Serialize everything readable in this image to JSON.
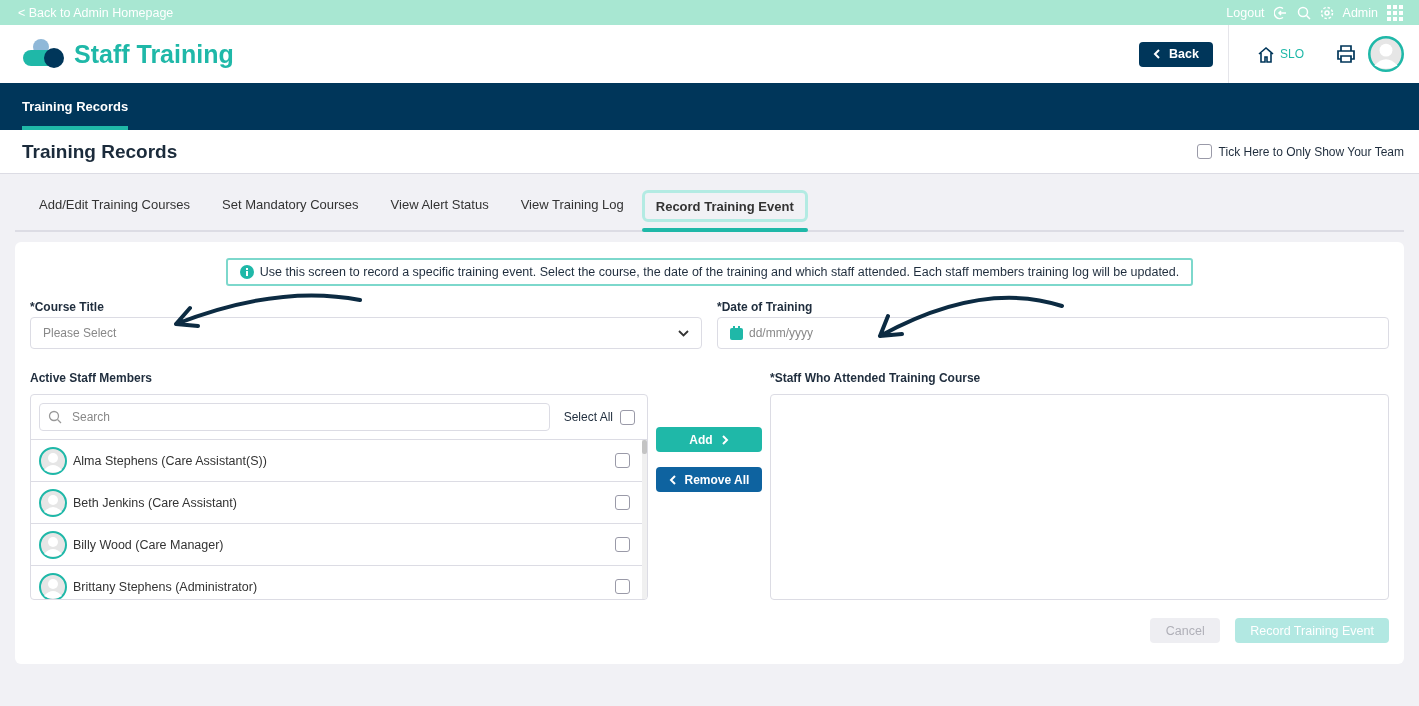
{
  "top_bar": {
    "back_link": "< Back to Admin Homepage",
    "logout": "Logout",
    "user": "Admin"
  },
  "header": {
    "app_title": "Staff Training",
    "back_button": "Back",
    "home_label": "SLO"
  },
  "nav": [
    {
      "label": "Training Records",
      "selected": true
    }
  ],
  "page": {
    "title": "Training Records",
    "team_filter": {
      "label": "Tick Here to Only Show Your Team",
      "checked": false
    }
  },
  "tabs": [
    {
      "label": "Add/Edit Training Courses",
      "selected": false
    },
    {
      "label": "Set Mandatory Courses",
      "selected": false
    },
    {
      "label": "View Alert Status",
      "selected": false
    },
    {
      "label": "View Training Log",
      "selected": false
    },
    {
      "label": "Record Training Event",
      "selected": true
    }
  ],
  "info": "Use this screen to record a specific training event. Select the course, the date of the training and which staff attended. Each staff members training log will be updated.",
  "course_title": {
    "label": "*Course Title",
    "placeholder": "Please Select"
  },
  "date_of_training": {
    "label": "*Date of Training",
    "placeholder": "dd/mm/yyyy"
  },
  "active_staff": {
    "label": "Active Staff Members",
    "search_placeholder": "Search",
    "select_all": {
      "label": "Select All",
      "checked": false
    },
    "members": [
      {
        "name": "Alma Stephens (Care Assistant(S))",
        "checked": false
      },
      {
        "name": "Beth Jenkins (Care Assistant)",
        "checked": false
      },
      {
        "name": "Billy Wood (Care Manager)",
        "checked": false
      },
      {
        "name": "Brittany Stephens (Administrator)",
        "checked": false
      }
    ]
  },
  "transfer_buttons": {
    "add": "Add",
    "remove_all": "Remove All"
  },
  "attended": {
    "label": "*Staff Who Attended Training Course"
  },
  "actions": [
    {
      "label": "Cancel",
      "kind": "secondary",
      "disabled": true
    },
    {
      "label": "Record Training Event",
      "kind": "primary",
      "disabled": true
    }
  ]
}
